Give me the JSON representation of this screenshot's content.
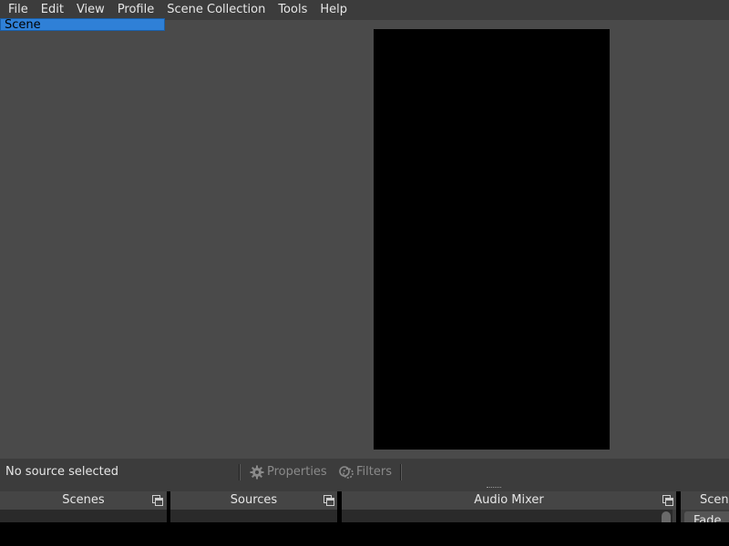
{
  "menu": {
    "items": [
      {
        "label": "File"
      },
      {
        "label": "Edit"
      },
      {
        "label": "View"
      },
      {
        "label": "Profile"
      },
      {
        "label": "Scene Collection"
      },
      {
        "label": "Tools"
      },
      {
        "label": "Help"
      }
    ]
  },
  "context_bar": {
    "status": "No source selected",
    "properties_label": "Properties",
    "filters_label": "Filters"
  },
  "docks": {
    "scenes": {
      "title": "Scenes",
      "items": [
        "Scene"
      ]
    },
    "sources": {
      "title": "Sources"
    },
    "audio_mixer": {
      "title": "Audio Mixer"
    },
    "transitions": {
      "title": "Scen",
      "selected": "Fade"
    }
  },
  "icons": {
    "properties": "gear-icon",
    "filters": "filters-icon",
    "dock_float": "float-window-icon"
  },
  "colors": {
    "menubar": "#3c3c3c",
    "preview_bg": "#4a4a4a",
    "canvas": "#000000",
    "selection": "#2f80d7",
    "disabled_text": "#8a8a8a"
  }
}
